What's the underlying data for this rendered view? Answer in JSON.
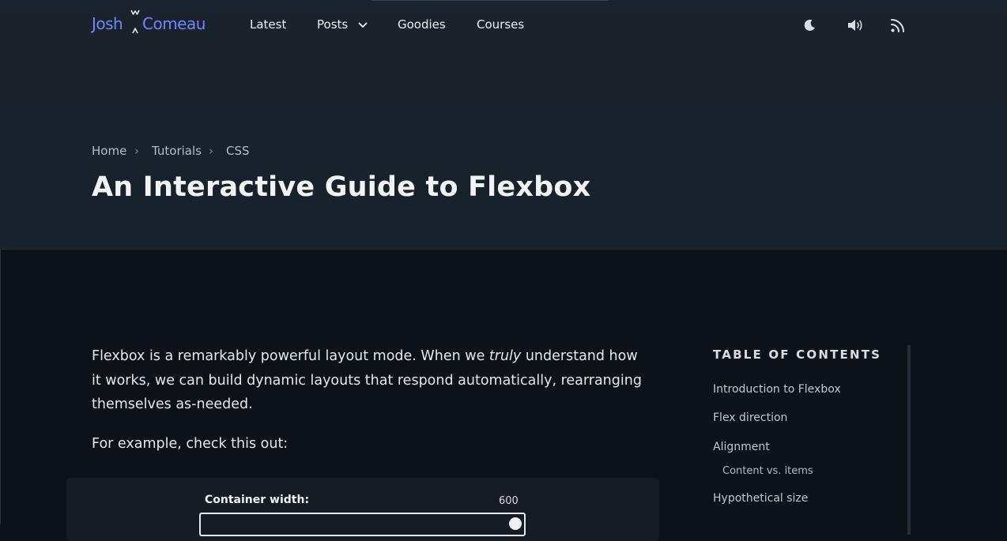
{
  "header": {
    "logo_first": "Josh",
    "logo_last": "Comeau",
    "nav": [
      {
        "label": "Latest"
      },
      {
        "label": "Posts",
        "icon": "chevron-down-icon"
      },
      {
        "label": "Goodies"
      },
      {
        "label": "Courses"
      }
    ],
    "icons": [
      "moon-icon",
      "speaker-icon",
      "rss-icon"
    ]
  },
  "breadcrumb": {
    "items": [
      "Home",
      "Tutorials",
      "CSS"
    ],
    "separator": "›"
  },
  "title": "An Interactive Guide to Flexbox",
  "intro": {
    "before": "Flexbox is a remarkably powerful layout mode. When we ",
    "emphasis": "truly",
    "after": " understand how it works, we can build dynamic layouts that respond automatically, rearranging themselves as-needed."
  },
  "example_text": "For example, check this out:",
  "demo": {
    "label": "Container width:",
    "value": "600"
  },
  "toc": {
    "heading": "TABLE OF CONTENTS",
    "items": [
      {
        "label": "Introduction to Flexbox"
      },
      {
        "label": "Flex direction"
      },
      {
        "label": "Alignment"
      },
      {
        "label": "Content vs. items"
      },
      {
        "label": "Hypothetical size"
      }
    ]
  },
  "colors": {
    "accent": "#6f86ff",
    "page_bg": "#0c1318",
    "hero_bg": "#17222d"
  }
}
